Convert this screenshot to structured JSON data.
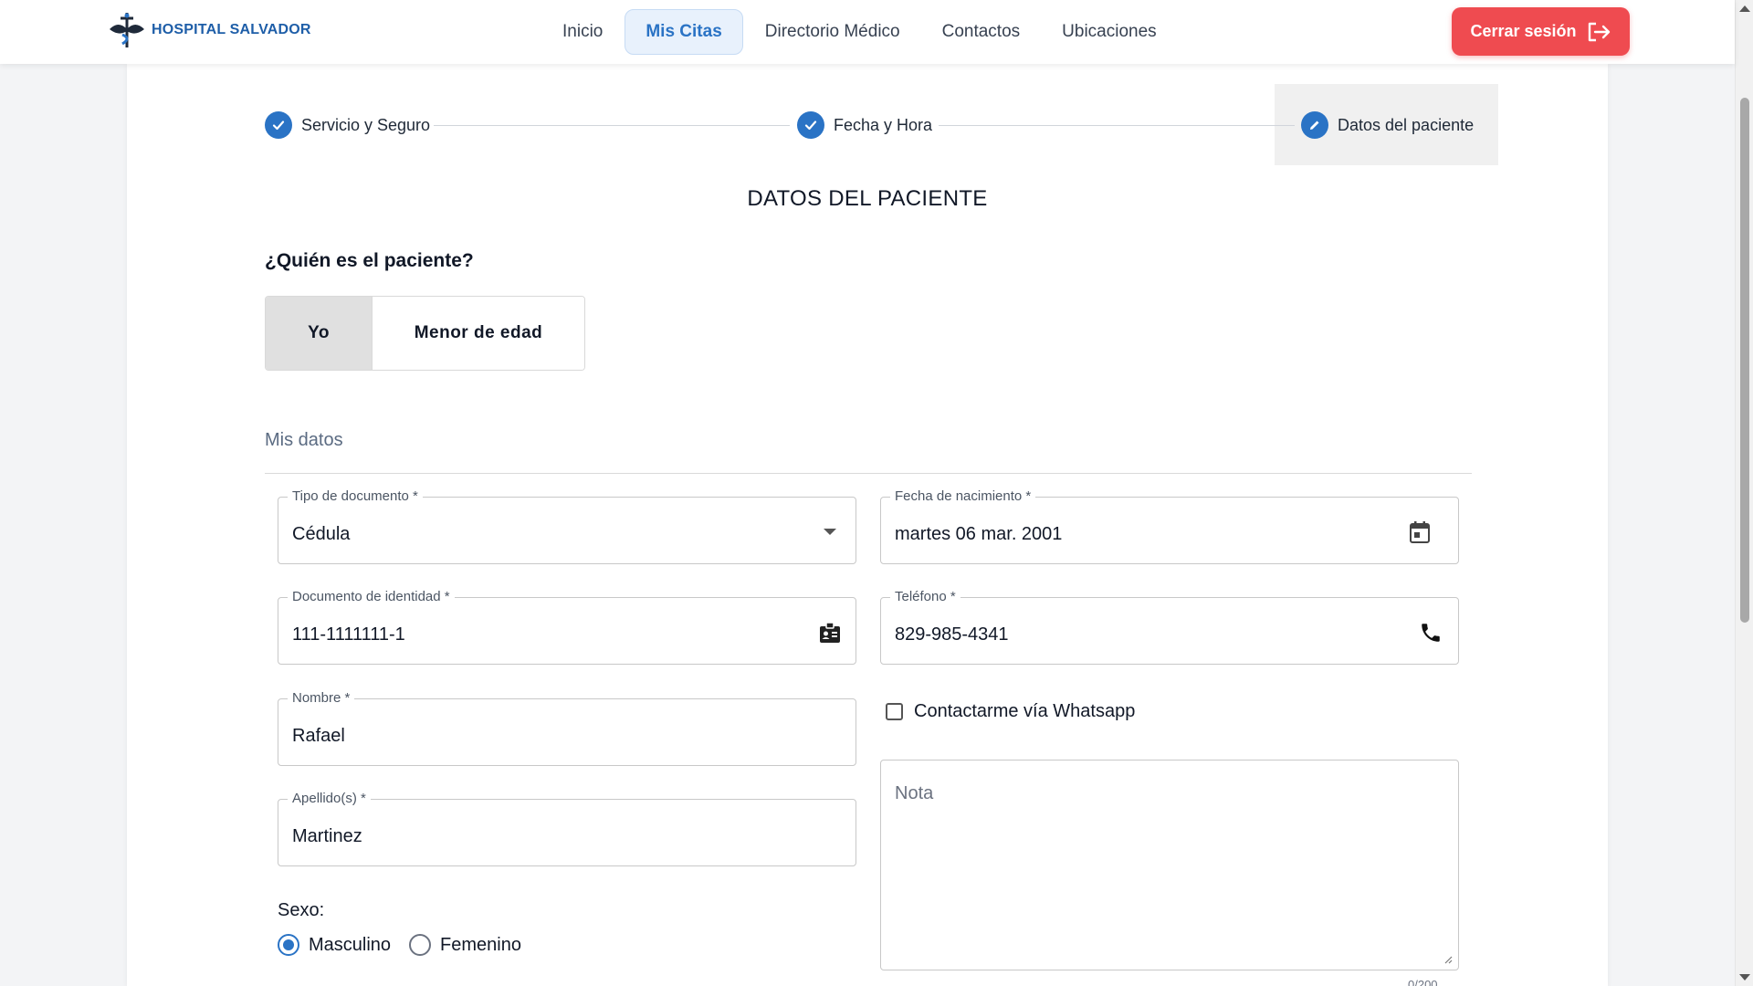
{
  "header": {
    "logo_text": "HOSPITAL SALVADOR",
    "nav": [
      "Inicio",
      "Mis Citas",
      "Directorio Médico",
      "Contactos",
      "Ubicaciones"
    ],
    "active_nav": "Mis Citas",
    "logout_label": "Cerrar sesión"
  },
  "stepper": {
    "steps": [
      {
        "label": "Servicio y Seguro",
        "state": "completed",
        "icon": "check-icon"
      },
      {
        "label": "Fecha y Hora",
        "state": "completed",
        "icon": "check-icon"
      },
      {
        "label": "Datos del paciente",
        "state": "active",
        "icon": "pencil-icon"
      }
    ]
  },
  "form": {
    "title": "DATOS DEL PACIENTE",
    "question": "¿Quién es el paciente?",
    "patient_options": [
      "Yo",
      "Menor de edad"
    ],
    "selected_option": "Yo",
    "section": "Mis datos",
    "fields": {
      "doc_type": {
        "label": "Tipo de documento *",
        "value": "Cédula",
        "icon": "chevron-down-icon"
      },
      "birth_date": {
        "label": "Fecha de nacimiento *",
        "value": "martes 06 mar. 2001",
        "icon": "calendar-icon"
      },
      "doc_id": {
        "label": "Documento de identidad *",
        "value": "111-1111111-1",
        "icon": "id-card-icon"
      },
      "phone": {
        "label": "Teléfono *",
        "value": "829-985-4341",
        "icon": "phone-icon"
      },
      "first_name": {
        "label": "Nombre *",
        "value": "Rafael"
      },
      "last_name": {
        "label": "Apellido(s) *",
        "value": "Martinez"
      }
    },
    "whatsapp_label": "Contactarme vía Whatsapp",
    "whatsapp_checked": false,
    "note_placeholder": "Nota",
    "note_counter": "0/200",
    "sex_label": "Sexo:",
    "sex_options": [
      "Masculino",
      "Femenino"
    ],
    "sex_selected": "Masculino"
  },
  "colors": {
    "primary": "#2a73c5",
    "danger": "#ef4b50",
    "brand": "#1e5ea8"
  }
}
